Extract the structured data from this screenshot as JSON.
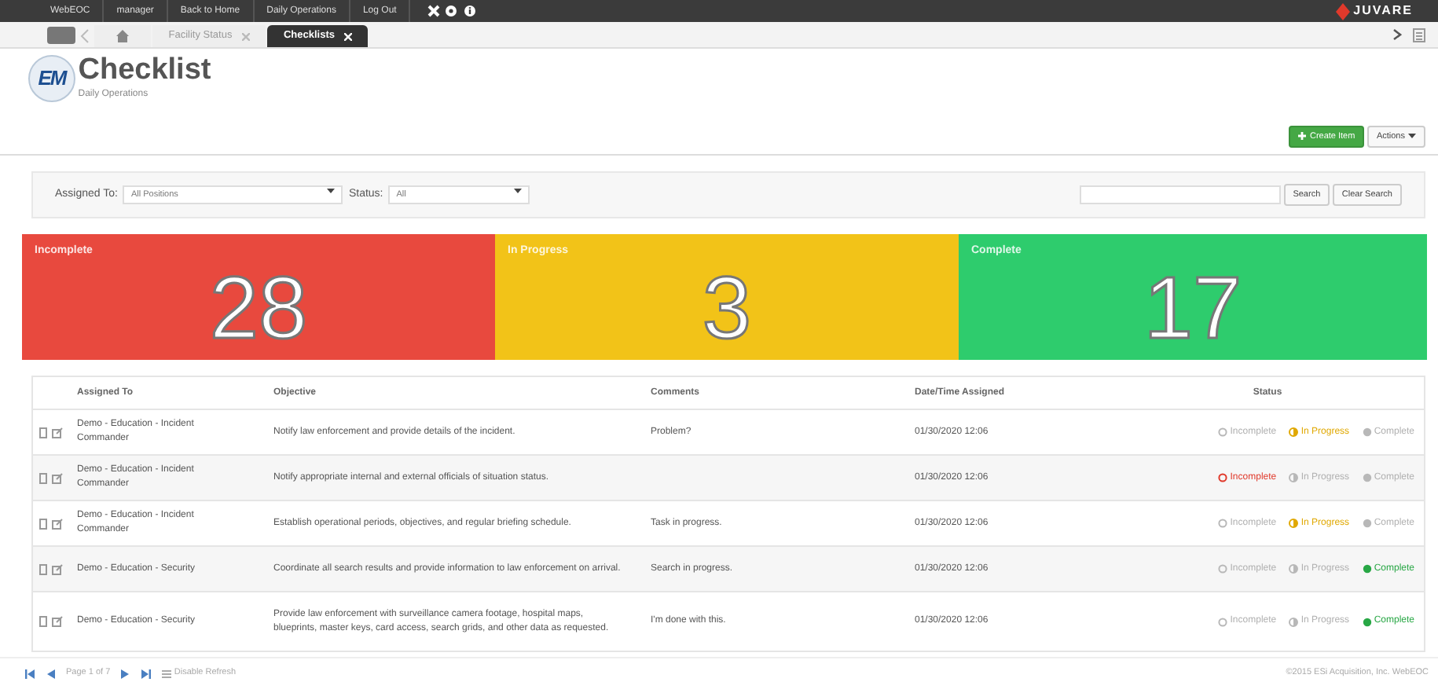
{
  "top_bar": {
    "links": [
      "WebEOC",
      "manager",
      "Back to Home",
      "Daily Operations",
      "Log Out"
    ],
    "brand": "JUVARE"
  },
  "tabs": [
    {
      "label": "Facility Status",
      "selected": false
    },
    {
      "label": "Checklists",
      "selected": true
    }
  ],
  "header": {
    "logo_text": "EM",
    "title": "Checklist",
    "subtitle": "Daily Operations",
    "buttons": [
      {
        "label": "Create Item",
        "kind": "primary"
      },
      {
        "label": "Actions",
        "kind": "dropdown"
      }
    ]
  },
  "filters": {
    "assigned_label": "Assigned To:",
    "assigned_value": "All Positions",
    "status_label": "Status:",
    "status_value": "All",
    "search_buttons": [
      "Search",
      "Clear Search"
    ]
  },
  "tiles": [
    {
      "label": "Incomplete",
      "count": "28",
      "color": "#e8493e"
    },
    {
      "label": "In Progress",
      "count": "3",
      "color": "#f2c318"
    },
    {
      "label": "Complete",
      "count": "17",
      "color": "#2ecc6d"
    }
  ],
  "table": {
    "columns": [
      "Assigned To",
      "Objective",
      "Comments",
      "Date/Time Assigned",
      "Status"
    ],
    "rows": [
      {
        "assigned": "Demo - Education - Incident Commander",
        "objective": "Notify law enforcement and provide details of the incident.",
        "comments": "Problem?",
        "date": "01/30/2020 12:06",
        "status": [
          {
            "label": "Incomplete",
            "selected": false
          },
          {
            "label": "In Progress",
            "selected": true
          },
          {
            "label": "Complete",
            "selected": false
          }
        ]
      },
      {
        "assigned": "Demo - Education - Incident Commander",
        "objective": "Notify appropriate internal and external officials of situation status.",
        "date": "01/30/2020 12:06",
        "status": [
          {
            "label": "Incomplete",
            "selected": true
          },
          {
            "label": "In Progress",
            "selected": false
          },
          {
            "label": "Complete",
            "selected": false
          }
        ]
      },
      {
        "assigned": "Demo - Education - Incident Commander",
        "objective": "Establish operational periods, objectives, and regular briefing schedule.",
        "comments": "Task in progress.",
        "date": "01/30/2020 12:06",
        "status": [
          {
            "label": "Incomplete",
            "selected": false
          },
          {
            "label": "In Progress",
            "selected": true
          },
          {
            "label": "Complete",
            "selected": false
          }
        ]
      },
      {
        "assigned": "Demo - Education - Security",
        "objective": "Coordinate all search results and provide information to law enforcement on arrival.",
        "comments": "Search in progress.",
        "date": "01/30/2020 12:06",
        "status": [
          {
            "label": "Incomplete",
            "selected": false
          },
          {
            "label": "In Progress",
            "selected": false
          },
          {
            "label": "Complete",
            "selected": true
          }
        ]
      },
      {
        "assigned": "Demo - Education - Security",
        "objective": "Provide law enforcement with surveillance camera footage, hospital maps, blueprints, master keys, card access, search grids, and other data as requested.",
        "comments": "I'm done with this.",
        "date": "01/30/2020 12:06",
        "status": [
          {
            "label": "Incomplete",
            "selected": false
          },
          {
            "label": "In Progress",
            "selected": false
          },
          {
            "label": "Complete",
            "selected": true
          }
        ]
      }
    ]
  },
  "footer": {
    "page": "Page 1 of 7",
    "refresh": "Disable Refresh",
    "copyright": "©2015 ESi Acquisition, Inc. WebEOC"
  }
}
